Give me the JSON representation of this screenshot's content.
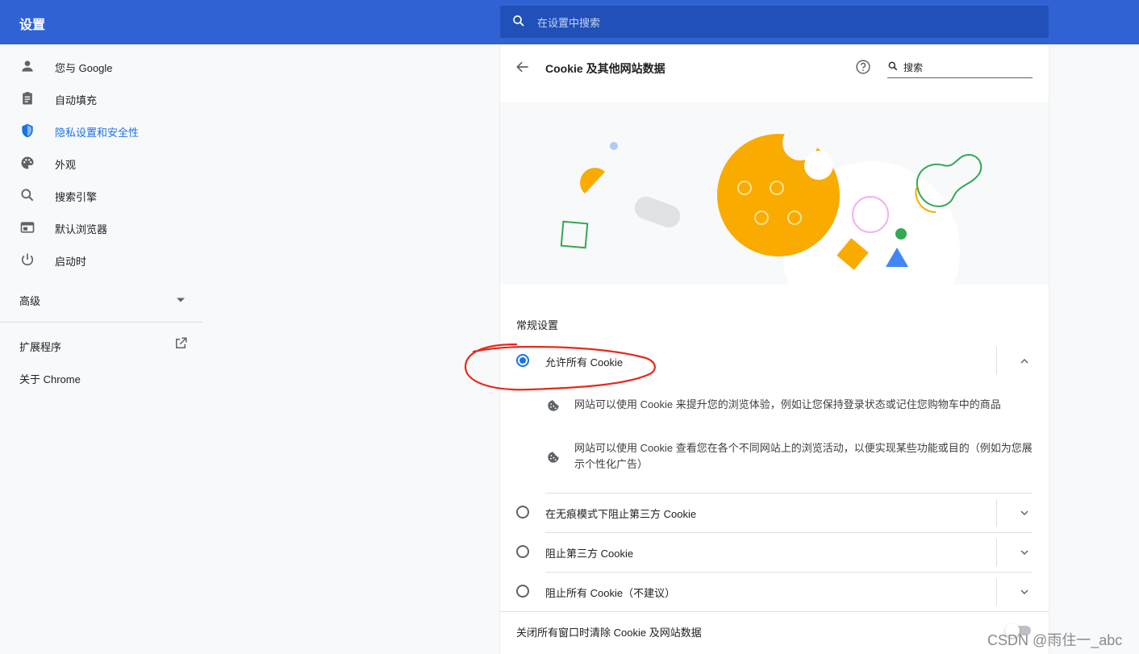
{
  "header": {
    "title": "设置",
    "search_placeholder": "在设置中搜索"
  },
  "sidebar": {
    "items": [
      {
        "label": "您与 Google",
        "icon": "person-icon"
      },
      {
        "label": "自动填充",
        "icon": "clipboard-icon"
      },
      {
        "label": "隐私设置和安全性",
        "icon": "shield-icon",
        "active": true
      },
      {
        "label": "外观",
        "icon": "palette-icon"
      },
      {
        "label": "搜索引擎",
        "icon": "search-icon"
      },
      {
        "label": "默认浏览器",
        "icon": "browser-window-icon"
      },
      {
        "label": "启动时",
        "icon": "power-icon"
      }
    ],
    "advanced_label": "高级",
    "extensions_label": "扩展程序",
    "about_label": "关于 Chrome"
  },
  "page": {
    "title": "Cookie 及其他网站数据",
    "search_placeholder": "搜索",
    "section_label": "常规设置",
    "options": [
      {
        "label": "允许所有 Cookie",
        "checked": true,
        "expanded": true
      },
      {
        "label": "在无痕模式下阻止第三方 Cookie",
        "checked": false
      },
      {
        "label": "阻止第三方 Cookie",
        "checked": false
      },
      {
        "label": "阻止所有 Cookie（不建议）",
        "checked": false
      }
    ],
    "details": [
      "网站可以使用 Cookie 来提升您的浏览体验，例如让您保持登录状态或记住您购物车中的商品",
      "网站可以使用 Cookie 查看您在各个不同网站上的浏览活动，以便实现某些功能或目的（例如为您展示个性化广告）"
    ],
    "clear_on_exit_label": "关闭所有窗口时清除 Cookie 及网站数据",
    "clear_on_exit_enabled": false
  },
  "colors": {
    "header_bg": "#3062d4",
    "accent": "#1a73e8",
    "annotation": "#e8281b",
    "cookie": "#f9ab00"
  },
  "watermark": "CSDN @雨住一_abc"
}
